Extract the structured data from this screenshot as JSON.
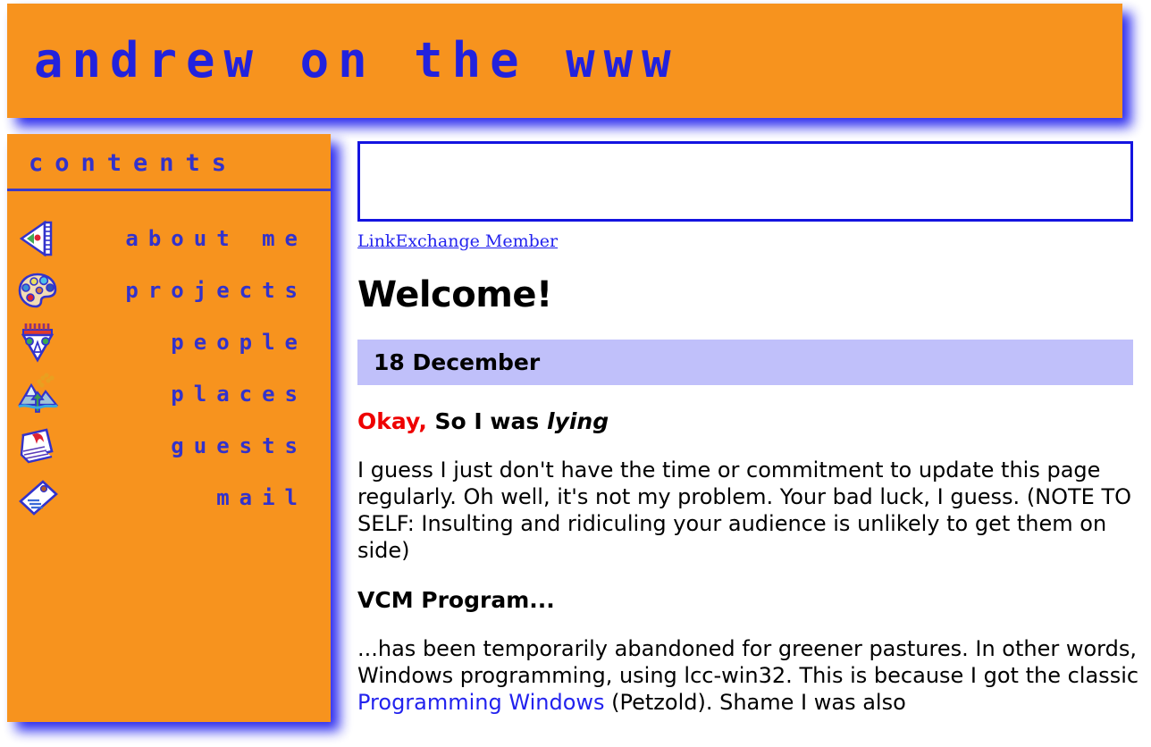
{
  "banner": {
    "title": "andrew on the www",
    "background_color": "#f7931e",
    "text_color": "#2222dd",
    "shadow_color": "#2222ee"
  },
  "sidebar": {
    "heading": "contents",
    "background_color": "#f7931e",
    "text_color": "#3232cc",
    "items": [
      {
        "label": "about me",
        "icon": "pen-nib-icon"
      },
      {
        "label": "projects",
        "icon": "paint-palette-icon"
      },
      {
        "label": "people",
        "icon": "tribal-mask-icon"
      },
      {
        "label": "places",
        "icon": "mountain-landscape-icon"
      },
      {
        "label": "guests",
        "icon": "guestbook-icon"
      },
      {
        "label": "mail",
        "icon": "envelope-letter-icon"
      }
    ]
  },
  "content": {
    "ad_banner": {
      "alt": "",
      "border_color": "#1414e0"
    },
    "linkexchange": {
      "label": "LinkExchange Member",
      "color": "#2222ee"
    },
    "page_title": "Welcome!",
    "date_bar": {
      "label": "18 December",
      "background_color": "#c0c0fa"
    },
    "entries": [
      {
        "heading_highlight": "Okay,",
        "heading_highlight_color": "#ee0000",
        "heading_plain": " So I was ",
        "heading_italic": "lying",
        "paragraph": "I guess I just don't have the time or commitment to update this page regularly. Oh well, it's not my problem. Your bad luck, I guess. (NOTE TO SELF: Insulting and ridiculing your audience is unlikely to get them on side)"
      },
      {
        "heading_plain": "VCM Program...",
        "paragraph_part1": "...has been temporarily abandoned for greener pastures. In other words, Windows programming, using lcc-win32. This is because I ",
        "paragraph_part2": "got the classic ",
        "link_text": "Programming Windows",
        "paragraph_part3": " (Petzold). Shame I was also"
      }
    ]
  }
}
